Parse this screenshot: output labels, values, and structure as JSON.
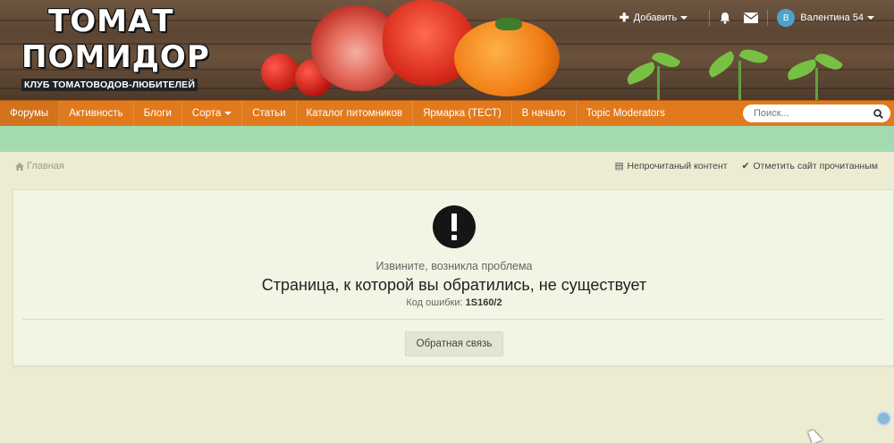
{
  "logo": {
    "line1": "ТОМАТ",
    "line2": "ПОМИДОР",
    "tagline": "КЛУБ ТОМАТОВОДОВ-ЛЮБИТЕЛЕЙ"
  },
  "user_nav": {
    "add_label": "Добавить",
    "user_initial": "В",
    "user_name": "Валентина 54"
  },
  "nav": {
    "items": [
      {
        "label": "Форумы"
      },
      {
        "label": "Активность"
      },
      {
        "label": "Блоги"
      },
      {
        "label": "Сорта"
      },
      {
        "label": "Статьи"
      },
      {
        "label": "Каталог питомников"
      },
      {
        "label": "Ярмарка (ТЕСТ)"
      },
      {
        "label": "В начало"
      },
      {
        "label": "Topic Moderators"
      }
    ],
    "search_placeholder": "Поиск..."
  },
  "breadcrumb": {
    "home": "Главная"
  },
  "actions": {
    "unread": "Непрочитаный контент",
    "mark_read": "Отметить сайт прочитанным"
  },
  "error": {
    "subtitle": "Извините, возникла проблема",
    "title": "Страница, к которой вы обратились, не существует",
    "code_label": "Код ошибки:",
    "code": "1S160/2",
    "feedback_button": "Обратная связь"
  },
  "colors": {
    "nav": "#e07a1d",
    "band": "#a3dbb0",
    "background": "#ebecd2",
    "card": "#f1f5e4"
  }
}
